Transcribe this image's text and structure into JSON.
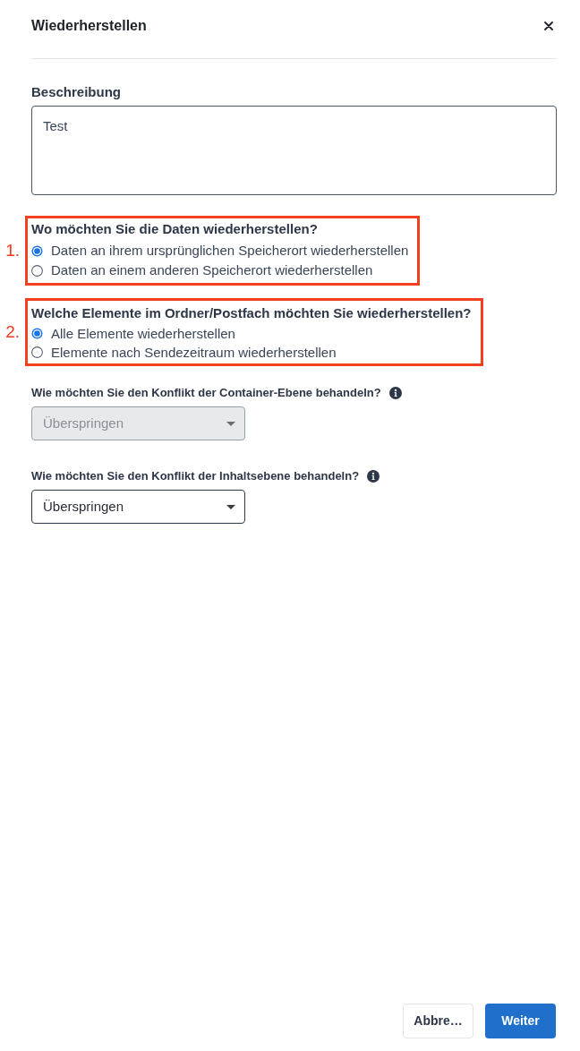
{
  "dialog": {
    "title": "Wiederherstellen"
  },
  "description": {
    "label": "Beschreibung",
    "value": "Test"
  },
  "questions": [
    {
      "annotation": "1.",
      "title": "Wo möchten Sie die Daten wiederherstellen?",
      "options": [
        {
          "label": "Daten an ihrem ursprünglichen Speicherort wiederherstellen",
          "selected": true
        },
        {
          "label": "Daten an einem anderen Speicherort wiederherstellen",
          "selected": false
        }
      ]
    },
    {
      "annotation": "2.",
      "title": "Welche Elemente im Ordner/Postfach möchten Sie wiederherstellen?",
      "options": [
        {
          "label": "Alle Elemente wiederherstellen",
          "selected": true
        },
        {
          "label": "Elemente nach Sendezeitraum wiederherstellen",
          "selected": false
        }
      ]
    }
  ],
  "conflicts": [
    {
      "label": "Wie möchten Sie den Konflikt der Container-Ebene behandeln?",
      "value": "Überspringen",
      "disabled": true
    },
    {
      "label": "Wie möchten Sie den Konflikt der Inhaltsebene behandeln?",
      "value": "Überspringen",
      "disabled": false
    }
  ],
  "buttons": [
    {
      "label": "Abbre…",
      "kind": "secondary"
    },
    {
      "label": "Weiter",
      "kind": "primary"
    }
  ]
}
